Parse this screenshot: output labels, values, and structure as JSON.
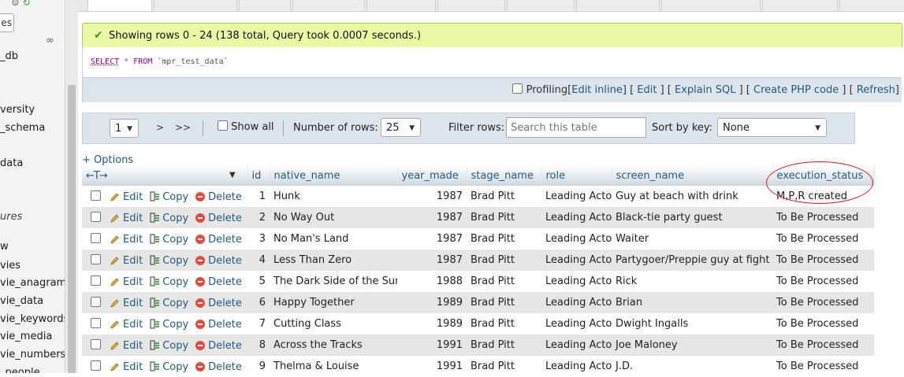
{
  "sidebar": {
    "top_text": "·",
    "pill_text": "es",
    "link_text": "∞",
    "items": [
      {
        "label": "_db",
        "italic": false
      },
      {
        "label": "versity",
        "italic": false
      },
      {
        "label": "_schema",
        "italic": false
      },
      {
        "label": "data",
        "italic": false
      },
      {
        "label": "ures",
        "italic": true
      },
      {
        "label": "w",
        "italic": false
      },
      {
        "label": "vies",
        "italic": false
      },
      {
        "label": "vie_anagrams",
        "italic": false
      },
      {
        "label": "vie_data",
        "italic": false
      },
      {
        "label": "vie_keywords",
        "italic": false
      },
      {
        "label": "vie_media",
        "italic": false
      },
      {
        "label": "vie_numbers",
        "italic": false
      },
      {
        "label": "_people",
        "italic": false
      }
    ]
  },
  "message": {
    "text": "Showing rows 0 - 24 (138 total, Query took 0.0007 seconds.)",
    "color_bg": "#ebf8a4",
    "color_border": "#a2d246"
  },
  "sql": {
    "select": "SELECT",
    "star": "*",
    "from": "FROM",
    "table": "`mpr_test_data`"
  },
  "sql_links": {
    "profiling": "Profiling",
    "edit_inline": "Edit inline",
    "edit": "Edit",
    "explain": "Explain SQL",
    "create_php": "Create PHP code",
    "refresh": "Refresh"
  },
  "nav": {
    "page": "1",
    "next": ">",
    "last": ">>",
    "show_all": "Show all",
    "rows_label": "Number of rows:",
    "rows_value": "25",
    "filter_label": "Filter rows:",
    "filter_placeholder": "Search this table",
    "sort_label": "Sort by key:",
    "sort_value": "None"
  },
  "options_label": "+ Options",
  "table": {
    "arrows": "←T→",
    "columns": [
      "id",
      "native_name",
      "year_made",
      "stage_name",
      "role",
      "screen_name",
      "execution_status"
    ],
    "actions": {
      "edit": "Edit",
      "copy": "Copy",
      "delete": "Delete"
    },
    "rows": [
      [
        "1",
        "Hunk",
        "1987",
        "Brad Pitt",
        "Leading Actor",
        "Guy at beach with drink",
        "M,P,R created"
      ],
      [
        "2",
        "No Way Out",
        "1987",
        "Brad Pitt",
        "Leading Actor",
        "Black-tie party guest",
        "To Be Processed"
      ],
      [
        "3",
        "No Man's Land",
        "1987",
        "Brad Pitt",
        "Leading Actor",
        "Waiter",
        "To Be Processed"
      ],
      [
        "4",
        "Less Than Zero",
        "1987",
        "Brad Pitt",
        "Leading Actor",
        "Partygoer/Preppie guy at fight",
        "To Be Processed"
      ],
      [
        "5",
        "The Dark Side of the Sun",
        "1988",
        "Brad Pitt",
        "Leading Actor",
        "Rick",
        "To Be Processed"
      ],
      [
        "6",
        "Happy Together",
        "1989",
        "Brad Pitt",
        "Leading Actor",
        "Brian",
        "To Be Processed"
      ],
      [
        "7",
        "Cutting Class",
        "1989",
        "Brad Pitt",
        "Leading Actor",
        "Dwight Ingalls",
        "To Be Processed"
      ],
      [
        "8",
        "Across the Tracks",
        "1991",
        "Brad Pitt",
        "Leading Actor",
        "Joe Maloney",
        "To Be Processed"
      ],
      [
        "9",
        "Thelma & Louise",
        "1991",
        "Brad Pitt",
        "Leading Actor",
        "J.D.",
        "To Be Processed"
      ]
    ]
  },
  "colors": {
    "link": "#235a81",
    "annotation": "#d21e1e",
    "row_alt": "#e6e6e6"
  }
}
